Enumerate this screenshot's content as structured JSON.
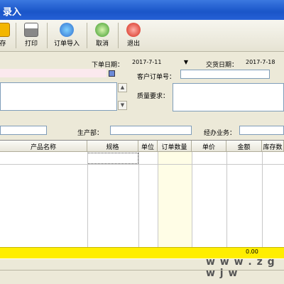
{
  "window": {
    "title": "录入"
  },
  "toolbar": {
    "save": "存",
    "print": "打印",
    "import": "订单导入",
    "cancel": "取消",
    "exit": "退出"
  },
  "form": {
    "order_date_label": "下单日期：",
    "order_date_value": "2017-7-11",
    "delivery_date_label": "交货日期：",
    "delivery_date_value": "2017-7-18",
    "customer_order_label": "客户订单号：",
    "customer_order_value": "",
    "quality_label": "质量要求：",
    "production_dept_label": "生产部：",
    "salesperson_label": "经办业务："
  },
  "grid": {
    "columns": [
      "产品名称",
      "规格",
      "单位",
      "订单数量",
      "单价",
      "金额",
      "库存数"
    ],
    "total_amount": "0.00"
  },
  "watermark": "w w w . z g w j w",
  "colors": {
    "title_bar": "#2560d6",
    "total_row": "#ffee00",
    "order_qty_column": "#fffde6"
  }
}
